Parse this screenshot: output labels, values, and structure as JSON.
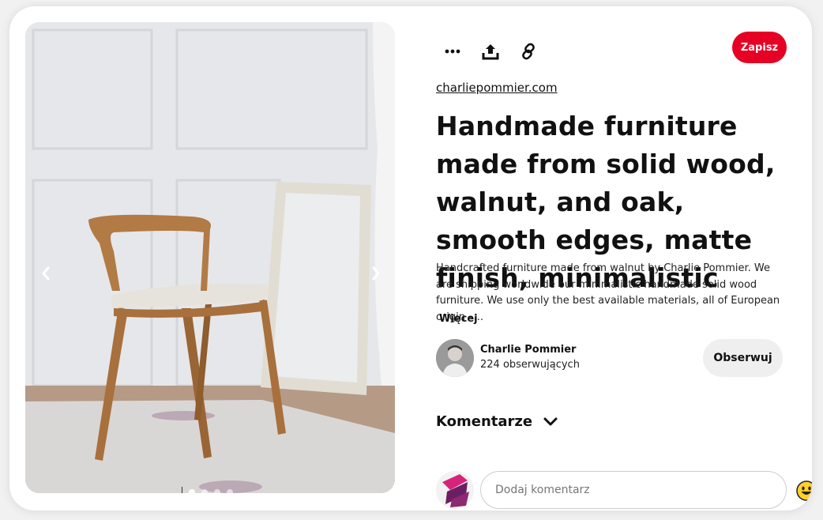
{
  "pin": {
    "source": "charliepommier.com",
    "title": "Handmade furniture made from solid wood, walnut, and oak, smooth edges, matte finish, minimalistic",
    "description": "Handcrafted furniture made from walnut by Charlie Pommier. We are shipping worldwide our minimalistic handmade solid wood furniture. We use only the best available materials, all of European origin –...",
    "more_label": "Więcej"
  },
  "toolbar": {
    "save_label": "Zapisz",
    "icons": [
      "more-icon",
      "share-icon",
      "link-icon"
    ]
  },
  "carousel": {
    "total": 4,
    "active_index": 0
  },
  "author": {
    "name": "Charlie Pommier",
    "followers": "224 obserwujących",
    "follow_label": "Obserwuj"
  },
  "comments": {
    "label": "Komentarze",
    "placeholder": "Dodaj komentarz"
  },
  "colors": {
    "brand_red": "#e60023",
    "follow_bg": "#efefef"
  }
}
